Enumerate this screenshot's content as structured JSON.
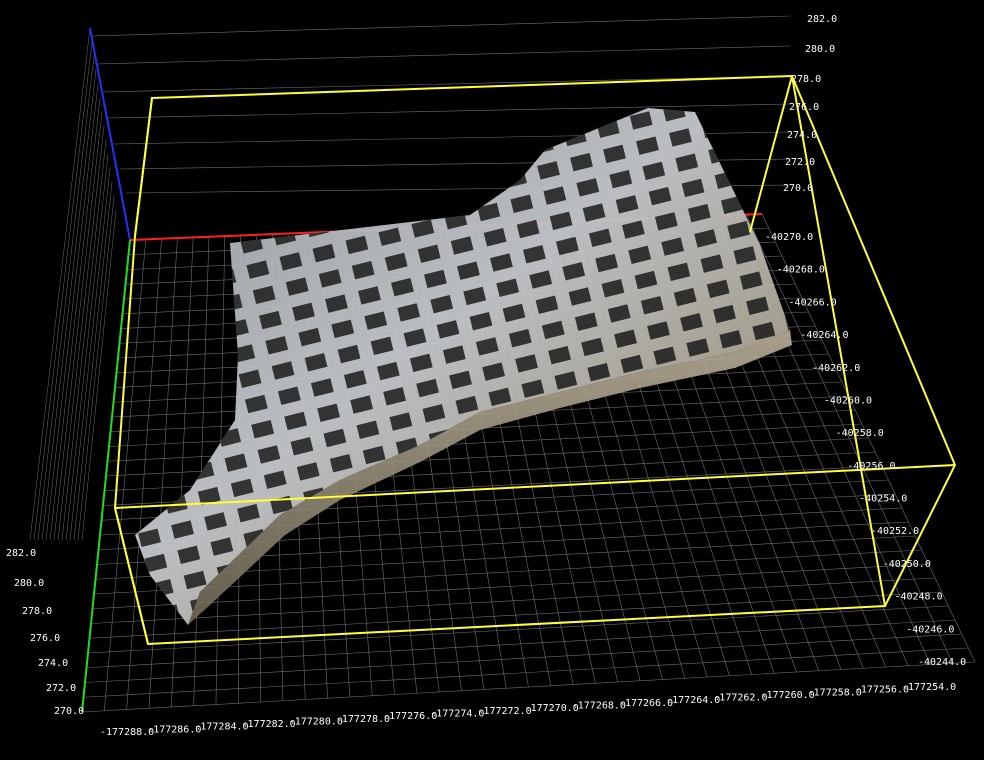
{
  "colors": {
    "background": "#000000",
    "grid": "#6f6f6f",
    "bounding_box": "#ffff33",
    "axis_x": "#ff2020",
    "axis_y": "#22dd22",
    "axis_z": "#2233ff",
    "label": "#ffffff"
  },
  "right_z_labels": [
    "282.0",
    "280.0",
    "278.0",
    "276.0",
    "274.0",
    "272.0",
    "270.0"
  ],
  "left_z_labels": [
    "282.0",
    "280.0",
    "278.0",
    "276.0",
    "274.0",
    "272.0",
    "270.0"
  ],
  "y_axis_labels": [
    "-40270.0",
    "-40268.0",
    "-40266.0",
    "-40264.0",
    "-40262.0",
    "-40260.0",
    "-40258.0",
    "-40256.0",
    "-40254.0",
    "-40252.0",
    "-40250.0",
    "-40248.0",
    "-40246.0",
    "-40244.0"
  ],
  "x_axis_labels": [
    "-177288.0",
    "-177286.0",
    "-177284.0",
    "-177282.0",
    "-177280.0",
    "-177278.0",
    "-177276.0",
    "-177274.0",
    "-177272.0",
    "-177270.0",
    "-177268.0",
    "-177266.0",
    "-177264.0",
    "-177262.0",
    "-177260.0",
    "-177258.0",
    "-177256.0",
    "-177254.0"
  ],
  "object": {
    "name": "point cloud mesh"
  }
}
